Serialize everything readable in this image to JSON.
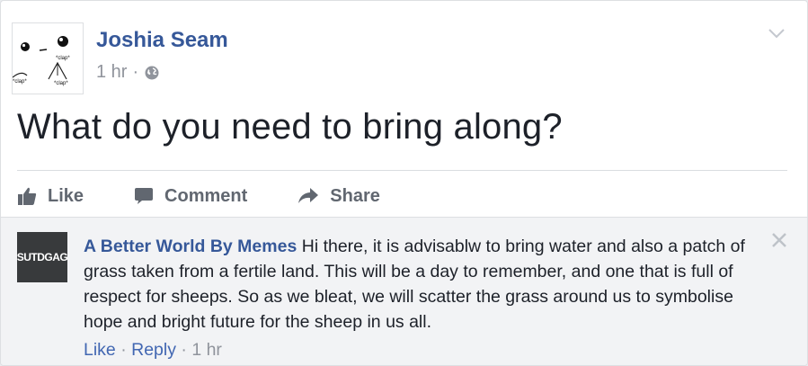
{
  "post": {
    "author": "Joshia Seam",
    "time": "1 hr",
    "separator": "·",
    "privacy_icon": "globe-icon",
    "text": "What do you need to bring along?",
    "avatar_captions": [
      "*clap*",
      "*clap*",
      "*clap*"
    ]
  },
  "actions": {
    "like": "Like",
    "comment": "Comment",
    "share": "Share"
  },
  "comment": {
    "author": "A Better World By Memes",
    "avatar_text": "SUTDGAG",
    "text": "Hi there, it is advisablw to bring water and also a patch of grass taken from a fertile land. This will be a day to remember, and one that is full of respect for sheeps. So as we bleat, we will scatter the grass around us to symbolise hope and bright future for the sheep in us all.",
    "like": "Like",
    "reply": "Reply",
    "time": "1 hr",
    "separator": "·"
  },
  "colors": {
    "link": "#365899",
    "muted": "#90949c",
    "action": "#616770",
    "comment_bg": "#f2f3f5"
  }
}
